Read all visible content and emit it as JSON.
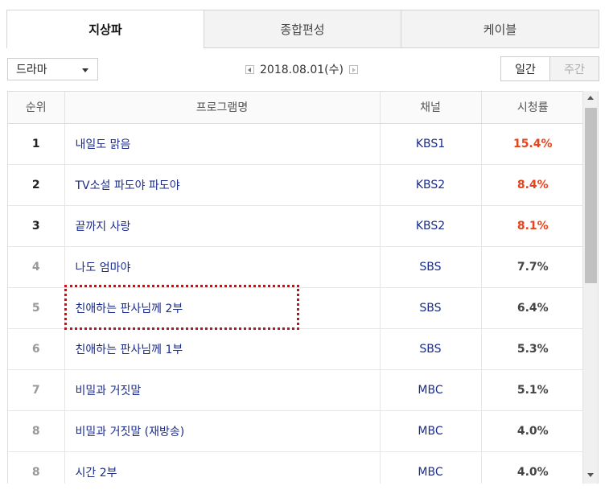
{
  "tabs": [
    {
      "label": "지상파",
      "active": true
    },
    {
      "label": "종합편성",
      "active": false
    },
    {
      "label": "케이블",
      "active": false
    }
  ],
  "genre_select": {
    "value": "드라마"
  },
  "date": "2018.08.01(수)",
  "period": {
    "daily": "일간",
    "weekly": "주간",
    "selected": "daily"
  },
  "table": {
    "headers": [
      "순위",
      "프로그램명",
      "채널",
      "시청률"
    ],
    "rows": [
      {
        "rank": "1",
        "program": "내일도 맑음",
        "channel": "KBS1",
        "rating": "15.4%"
      },
      {
        "rank": "2",
        "program": "TV소설 파도야 파도야",
        "channel": "KBS2",
        "rating": "8.4%"
      },
      {
        "rank": "3",
        "program": "끝까지 사랑",
        "channel": "KBS2",
        "rating": "8.1%"
      },
      {
        "rank": "4",
        "program": "나도 엄마야",
        "channel": "SBS",
        "rating": "7.7%"
      },
      {
        "rank": "5",
        "program": "친애하는 판사님께 2부",
        "channel": "SBS",
        "rating": "6.4%"
      },
      {
        "rank": "6",
        "program": "친애하는 판사님께 1부",
        "channel": "SBS",
        "rating": "5.3%"
      },
      {
        "rank": "7",
        "program": "비밀과 거짓말",
        "channel": "MBC",
        "rating": "5.1%"
      },
      {
        "rank": "8",
        "program": "비밀과 거짓말 (재방송)",
        "channel": "MBC",
        "rating": "4.0%"
      },
      {
        "rank": "8",
        "program": "시간 2부",
        "channel": "MBC",
        "rating": "4.0%"
      }
    ]
  },
  "colors": {
    "top_rating": "#e8431c",
    "link": "#1a2b8c",
    "highlight": "#c4121a"
  },
  "icons": {
    "prev": "arrow-left-icon",
    "next": "arrow-right-icon",
    "dropdown": "caret-down-icon"
  }
}
